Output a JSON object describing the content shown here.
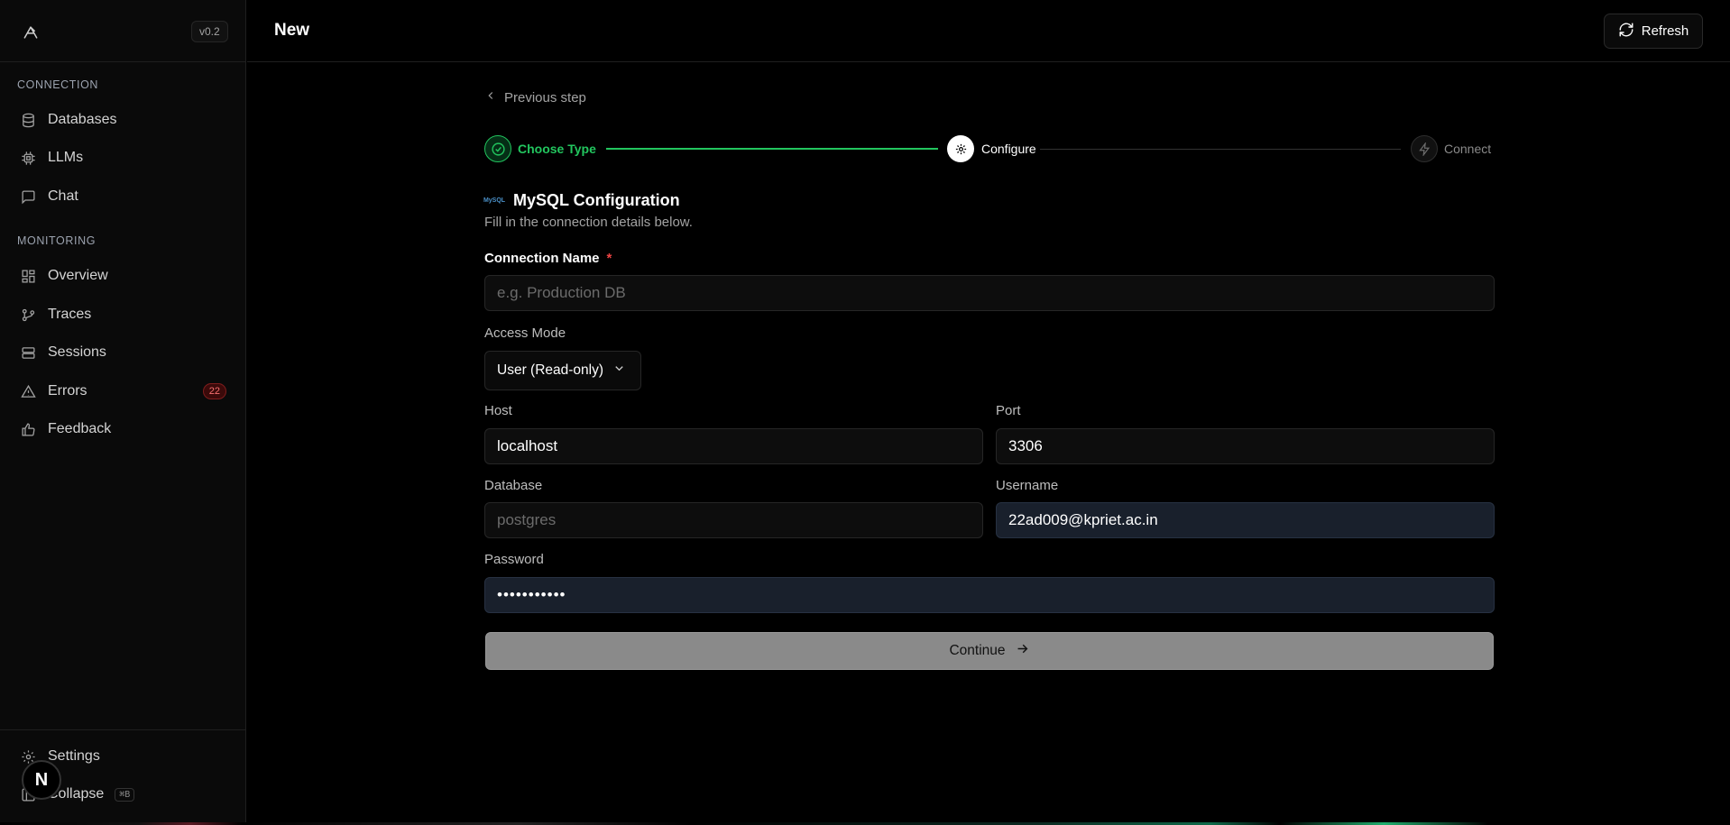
{
  "sidebar": {
    "version": "v0.2",
    "sections": [
      {
        "label": "CONNECTION",
        "items": [
          {
            "label": "Databases",
            "icon": "database-icon"
          },
          {
            "label": "LLMs",
            "icon": "cpu-icon"
          },
          {
            "label": "Chat",
            "icon": "message-square-icon"
          }
        ]
      },
      {
        "label": "MONITORING",
        "items": [
          {
            "label": "Overview",
            "icon": "layout-dashboard-icon"
          },
          {
            "label": "Traces",
            "icon": "git-branch-icon"
          },
          {
            "label": "Sessions",
            "icon": "server-icon"
          },
          {
            "label": "Errors",
            "icon": "alert-triangle-icon",
            "badge": "22"
          },
          {
            "label": "Feedback",
            "icon": "thumbs-up-icon"
          }
        ]
      }
    ],
    "footer": {
      "settings_label": "Settings",
      "collapse_label": "Collapse",
      "collapse_shortcut": "⌘B",
      "avatar_letter": "N"
    }
  },
  "header": {
    "title": "New",
    "refresh_label": "Refresh"
  },
  "wizard": {
    "previous_label": "Previous step",
    "steps": [
      {
        "label": "Choose Type",
        "state": "complete"
      },
      {
        "label": "Configure",
        "state": "current"
      },
      {
        "label": "Connect",
        "state": "pending"
      }
    ],
    "colors": {
      "accent": "#22c55e",
      "pending": "#3a3a3a"
    }
  },
  "form": {
    "title": "MySQL Configuration",
    "mysql_logo_text": "MySQL",
    "subtitle": "Fill in the connection details below.",
    "connection_name": {
      "label": "Connection Name",
      "required_mark": "*",
      "placeholder": "e.g. Production DB",
      "value": ""
    },
    "access_mode": {
      "label": "Access Mode",
      "value": "User (Read-only)"
    },
    "host": {
      "label": "Host",
      "value": "localhost"
    },
    "port": {
      "label": "Port",
      "value": "3306"
    },
    "database": {
      "label": "Database",
      "placeholder": "postgres",
      "value": ""
    },
    "username": {
      "label": "Username",
      "value": "22ad009@kpriet.ac.in"
    },
    "password": {
      "label": "Password",
      "value": "•••••••••••"
    },
    "continue_label": "Continue"
  }
}
